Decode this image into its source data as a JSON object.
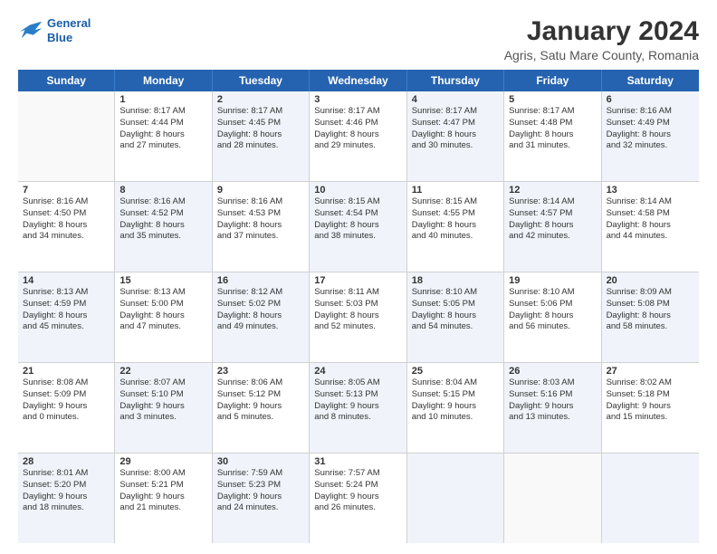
{
  "logo": {
    "line1": "General",
    "line2": "Blue"
  },
  "title": "January 2024",
  "subtitle": "Agris, Satu Mare County, Romania",
  "weekdays": [
    "Sunday",
    "Monday",
    "Tuesday",
    "Wednesday",
    "Thursday",
    "Friday",
    "Saturday"
  ],
  "rows": [
    [
      {
        "day": "",
        "lines": [],
        "shaded": false
      },
      {
        "day": "1",
        "lines": [
          "Sunrise: 8:17 AM",
          "Sunset: 4:44 PM",
          "Daylight: 8 hours",
          "and 27 minutes."
        ],
        "shaded": false
      },
      {
        "day": "2",
        "lines": [
          "Sunrise: 8:17 AM",
          "Sunset: 4:45 PM",
          "Daylight: 8 hours",
          "and 28 minutes."
        ],
        "shaded": true
      },
      {
        "day": "3",
        "lines": [
          "Sunrise: 8:17 AM",
          "Sunset: 4:46 PM",
          "Daylight: 8 hours",
          "and 29 minutes."
        ],
        "shaded": false
      },
      {
        "day": "4",
        "lines": [
          "Sunrise: 8:17 AM",
          "Sunset: 4:47 PM",
          "Daylight: 8 hours",
          "and 30 minutes."
        ],
        "shaded": true
      },
      {
        "day": "5",
        "lines": [
          "Sunrise: 8:17 AM",
          "Sunset: 4:48 PM",
          "Daylight: 8 hours",
          "and 31 minutes."
        ],
        "shaded": false
      },
      {
        "day": "6",
        "lines": [
          "Sunrise: 8:16 AM",
          "Sunset: 4:49 PM",
          "Daylight: 8 hours",
          "and 32 minutes."
        ],
        "shaded": true
      }
    ],
    [
      {
        "day": "7",
        "lines": [
          "Sunrise: 8:16 AM",
          "Sunset: 4:50 PM",
          "Daylight: 8 hours",
          "and 34 minutes."
        ],
        "shaded": false
      },
      {
        "day": "8",
        "lines": [
          "Sunrise: 8:16 AM",
          "Sunset: 4:52 PM",
          "Daylight: 8 hours",
          "and 35 minutes."
        ],
        "shaded": true
      },
      {
        "day": "9",
        "lines": [
          "Sunrise: 8:16 AM",
          "Sunset: 4:53 PM",
          "Daylight: 8 hours",
          "and 37 minutes."
        ],
        "shaded": false
      },
      {
        "day": "10",
        "lines": [
          "Sunrise: 8:15 AM",
          "Sunset: 4:54 PM",
          "Daylight: 8 hours",
          "and 38 minutes."
        ],
        "shaded": true
      },
      {
        "day": "11",
        "lines": [
          "Sunrise: 8:15 AM",
          "Sunset: 4:55 PM",
          "Daylight: 8 hours",
          "and 40 minutes."
        ],
        "shaded": false
      },
      {
        "day": "12",
        "lines": [
          "Sunrise: 8:14 AM",
          "Sunset: 4:57 PM",
          "Daylight: 8 hours",
          "and 42 minutes."
        ],
        "shaded": true
      },
      {
        "day": "13",
        "lines": [
          "Sunrise: 8:14 AM",
          "Sunset: 4:58 PM",
          "Daylight: 8 hours",
          "and 44 minutes."
        ],
        "shaded": false
      }
    ],
    [
      {
        "day": "14",
        "lines": [
          "Sunrise: 8:13 AM",
          "Sunset: 4:59 PM",
          "Daylight: 8 hours",
          "and 45 minutes."
        ],
        "shaded": true
      },
      {
        "day": "15",
        "lines": [
          "Sunrise: 8:13 AM",
          "Sunset: 5:00 PM",
          "Daylight: 8 hours",
          "and 47 minutes."
        ],
        "shaded": false
      },
      {
        "day": "16",
        "lines": [
          "Sunrise: 8:12 AM",
          "Sunset: 5:02 PM",
          "Daylight: 8 hours",
          "and 49 minutes."
        ],
        "shaded": true
      },
      {
        "day": "17",
        "lines": [
          "Sunrise: 8:11 AM",
          "Sunset: 5:03 PM",
          "Daylight: 8 hours",
          "and 52 minutes."
        ],
        "shaded": false
      },
      {
        "day": "18",
        "lines": [
          "Sunrise: 8:10 AM",
          "Sunset: 5:05 PM",
          "Daylight: 8 hours",
          "and 54 minutes."
        ],
        "shaded": true
      },
      {
        "day": "19",
        "lines": [
          "Sunrise: 8:10 AM",
          "Sunset: 5:06 PM",
          "Daylight: 8 hours",
          "and 56 minutes."
        ],
        "shaded": false
      },
      {
        "day": "20",
        "lines": [
          "Sunrise: 8:09 AM",
          "Sunset: 5:08 PM",
          "Daylight: 8 hours",
          "and 58 minutes."
        ],
        "shaded": true
      }
    ],
    [
      {
        "day": "21",
        "lines": [
          "Sunrise: 8:08 AM",
          "Sunset: 5:09 PM",
          "Daylight: 9 hours",
          "and 0 minutes."
        ],
        "shaded": false
      },
      {
        "day": "22",
        "lines": [
          "Sunrise: 8:07 AM",
          "Sunset: 5:10 PM",
          "Daylight: 9 hours",
          "and 3 minutes."
        ],
        "shaded": true
      },
      {
        "day": "23",
        "lines": [
          "Sunrise: 8:06 AM",
          "Sunset: 5:12 PM",
          "Daylight: 9 hours",
          "and 5 minutes."
        ],
        "shaded": false
      },
      {
        "day": "24",
        "lines": [
          "Sunrise: 8:05 AM",
          "Sunset: 5:13 PM",
          "Daylight: 9 hours",
          "and 8 minutes."
        ],
        "shaded": true
      },
      {
        "day": "25",
        "lines": [
          "Sunrise: 8:04 AM",
          "Sunset: 5:15 PM",
          "Daylight: 9 hours",
          "and 10 minutes."
        ],
        "shaded": false
      },
      {
        "day": "26",
        "lines": [
          "Sunrise: 8:03 AM",
          "Sunset: 5:16 PM",
          "Daylight: 9 hours",
          "and 13 minutes."
        ],
        "shaded": true
      },
      {
        "day": "27",
        "lines": [
          "Sunrise: 8:02 AM",
          "Sunset: 5:18 PM",
          "Daylight: 9 hours",
          "and 15 minutes."
        ],
        "shaded": false
      }
    ],
    [
      {
        "day": "28",
        "lines": [
          "Sunrise: 8:01 AM",
          "Sunset: 5:20 PM",
          "Daylight: 9 hours",
          "and 18 minutes."
        ],
        "shaded": true
      },
      {
        "day": "29",
        "lines": [
          "Sunrise: 8:00 AM",
          "Sunset: 5:21 PM",
          "Daylight: 9 hours",
          "and 21 minutes."
        ],
        "shaded": false
      },
      {
        "day": "30",
        "lines": [
          "Sunrise: 7:59 AM",
          "Sunset: 5:23 PM",
          "Daylight: 9 hours",
          "and 24 minutes."
        ],
        "shaded": true
      },
      {
        "day": "31",
        "lines": [
          "Sunrise: 7:57 AM",
          "Sunset: 5:24 PM",
          "Daylight: 9 hours",
          "and 26 minutes."
        ],
        "shaded": false
      },
      {
        "day": "",
        "lines": [],
        "shaded": true
      },
      {
        "day": "",
        "lines": [],
        "shaded": false
      },
      {
        "day": "",
        "lines": [],
        "shaded": true
      }
    ]
  ]
}
